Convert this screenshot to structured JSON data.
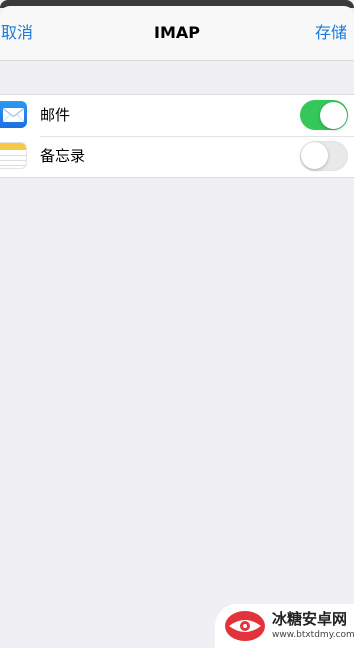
{
  "navbar": {
    "cancel_label": "取消",
    "title": "IMAP",
    "save_label": "存储"
  },
  "sync_items": [
    {
      "label": "邮件",
      "icon": "mail-icon",
      "enabled": true
    },
    {
      "label": "备忘录",
      "icon": "notes-icon",
      "enabled": false
    }
  ],
  "watermark": {
    "title": "冰糖安卓网",
    "url": "www.btxtdmy.com"
  },
  "colors": {
    "accent": "#1b7be0",
    "toggle_on": "#34c759",
    "background": "#efeff4"
  }
}
